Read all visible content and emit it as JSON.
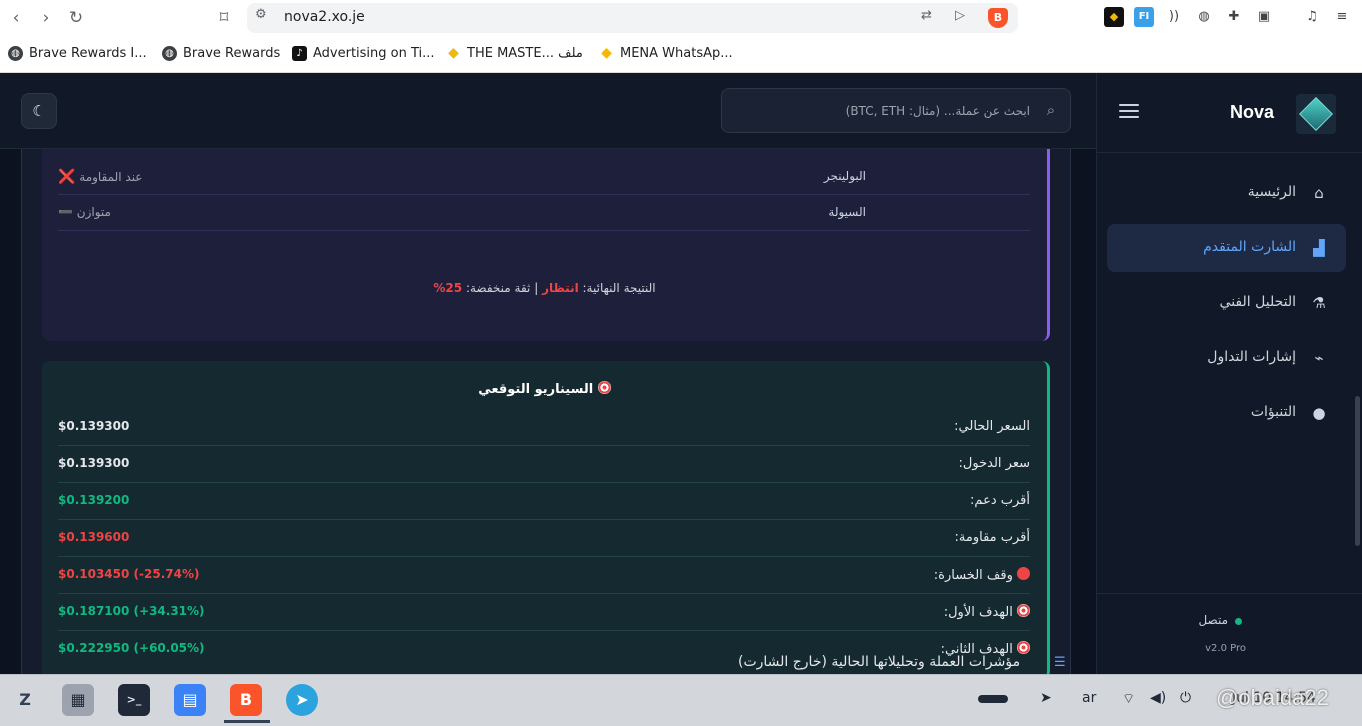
{
  "browser": {
    "url": "nova2.xo.je",
    "bookmarks": [
      {
        "label": "Brave Rewards I...",
        "icon": "globe-icon"
      },
      {
        "label": "Brave Rewards",
        "icon": "globe-icon"
      },
      {
        "label": "Advertising on Ti...",
        "icon": "tiktok-icon"
      },
      {
        "label": "THE MASTE... ملف",
        "icon": "binance-icon"
      },
      {
        "label": "MENA WhatsAp...",
        "icon": "binance-icon"
      }
    ]
  },
  "sidebar": {
    "brand": "Nova",
    "items": [
      {
        "label": "الرئيسية",
        "icon": "home-icon",
        "active": false
      },
      {
        "label": "الشارت المتقدم",
        "icon": "chart-icon",
        "active": true
      },
      {
        "label": "التحليل الفني",
        "icon": "microscope-icon",
        "active": false
      },
      {
        "label": "إشارات التداول",
        "icon": "satellite-icon",
        "active": false
      },
      {
        "label": "التنبؤات",
        "icon": "brain-icon",
        "active": false
      }
    ],
    "status": "متصل",
    "version": "v2.0 Pro"
  },
  "topbar": {
    "search_placeholder": "ابحث عن عملة... (مثال: BTC, ETH)"
  },
  "analysis": {
    "rows": [
      {
        "label": "البولينجر",
        "value": "عند المقاومة",
        "mark": "❌"
      },
      {
        "label": "السيولة",
        "value": "متوازن",
        "mark": "➖"
      }
    ],
    "final_prefix": "النتيجة النهائية:",
    "final_status": "انتظار",
    "final_sep": "|",
    "final_conf": "ثقة منخفضة:",
    "final_pct": "25%"
  },
  "scenario": {
    "title": "السيناريو التوقعي",
    "rows": [
      {
        "label": "السعر الحالي:",
        "value": "$0.139300",
        "tone": "white",
        "icon": ""
      },
      {
        "label": "سعر الدخول:",
        "value": "$0.139300",
        "tone": "white",
        "icon": ""
      },
      {
        "label": "أقرب دعم:",
        "value": "$0.139200",
        "tone": "green",
        "icon": ""
      },
      {
        "label": "أقرب مقاومة:",
        "value": "$0.139600",
        "tone": "red",
        "icon": ""
      },
      {
        "label": "وقف الخسارة:",
        "value": "$0.103450 (-25.74%)",
        "tone": "red",
        "icon": "stop"
      },
      {
        "label": "الهدف الأول:",
        "value": "$0.187100 (+34.31%)",
        "tone": "green",
        "icon": "target"
      },
      {
        "label": "الهدف الثاني:",
        "value": "$0.222950 (+60.05%)",
        "tone": "green",
        "icon": "target"
      }
    ]
  },
  "section": {
    "title": "مؤشرات العملة وتحليلاتها الحالية (خارج الشارت)"
  },
  "taskbar": {
    "lang": "ar",
    "watermark": "@obaida22",
    "clock": "Jul 10 14:54"
  },
  "colors": {
    "accent": "#60a5fa",
    "positive": "#10b981",
    "negative": "#ef4444",
    "analysis_border": "#8b5cf6"
  }
}
